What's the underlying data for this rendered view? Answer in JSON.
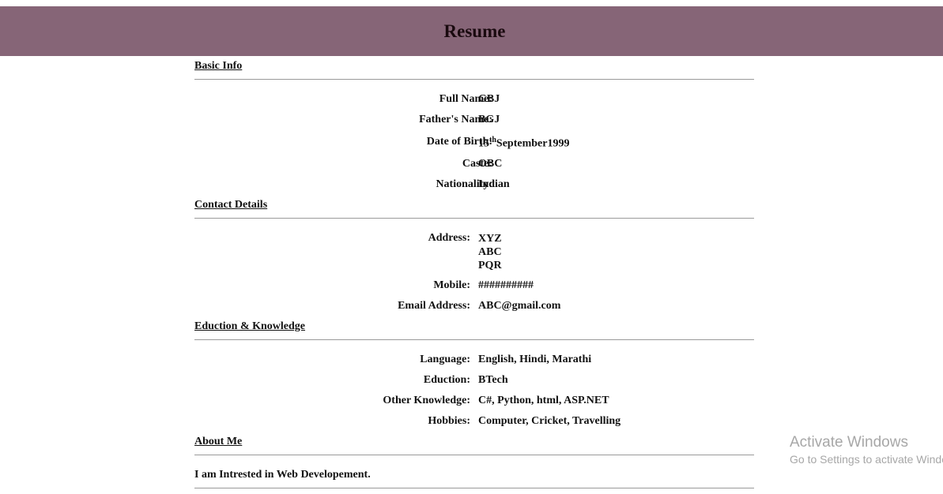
{
  "header": {
    "title": "Resume"
  },
  "basic_info": {
    "heading": "Basic Info",
    "full_name": {
      "label": "Full Name:",
      "value": "GBJ"
    },
    "father_name": {
      "label": "Father's Name:",
      "value": "BGJ"
    },
    "dob": {
      "label": "Date of Birth:",
      "day": "15",
      "suffix": "th",
      "rest": "September1999"
    },
    "caste": {
      "label": "Caste:",
      "value": "OBC"
    },
    "nationality": {
      "label": "Nationality:",
      "value": "Indian"
    }
  },
  "contact": {
    "heading": "Contact Details",
    "address": {
      "label": "Address:",
      "lines": [
        "XYZ",
        "ABC",
        "PQR"
      ]
    },
    "mobile": {
      "label": "Mobile:",
      "value": "##########"
    },
    "email": {
      "label": "Email Address:",
      "value": "ABC@gmail.com"
    }
  },
  "education": {
    "heading": "Eduction & Knowledge",
    "language": {
      "label": "Language:",
      "value": "English, Hindi, Marathi"
    },
    "eduction": {
      "label": "Eduction:",
      "value": "BTech"
    },
    "other_knowledge": {
      "label": "Other Knowledge:",
      "value": "C#, Python, html, ASP.NET"
    },
    "hobbies": {
      "label": "Hobbies:",
      "value": "Computer, Cricket, Travelling"
    }
  },
  "about": {
    "heading": "About Me",
    "text": "I am Intrested in Web Developement."
  },
  "watermark": {
    "title": "Activate Windows",
    "subtitle": "Go to Settings to activate Windows."
  }
}
